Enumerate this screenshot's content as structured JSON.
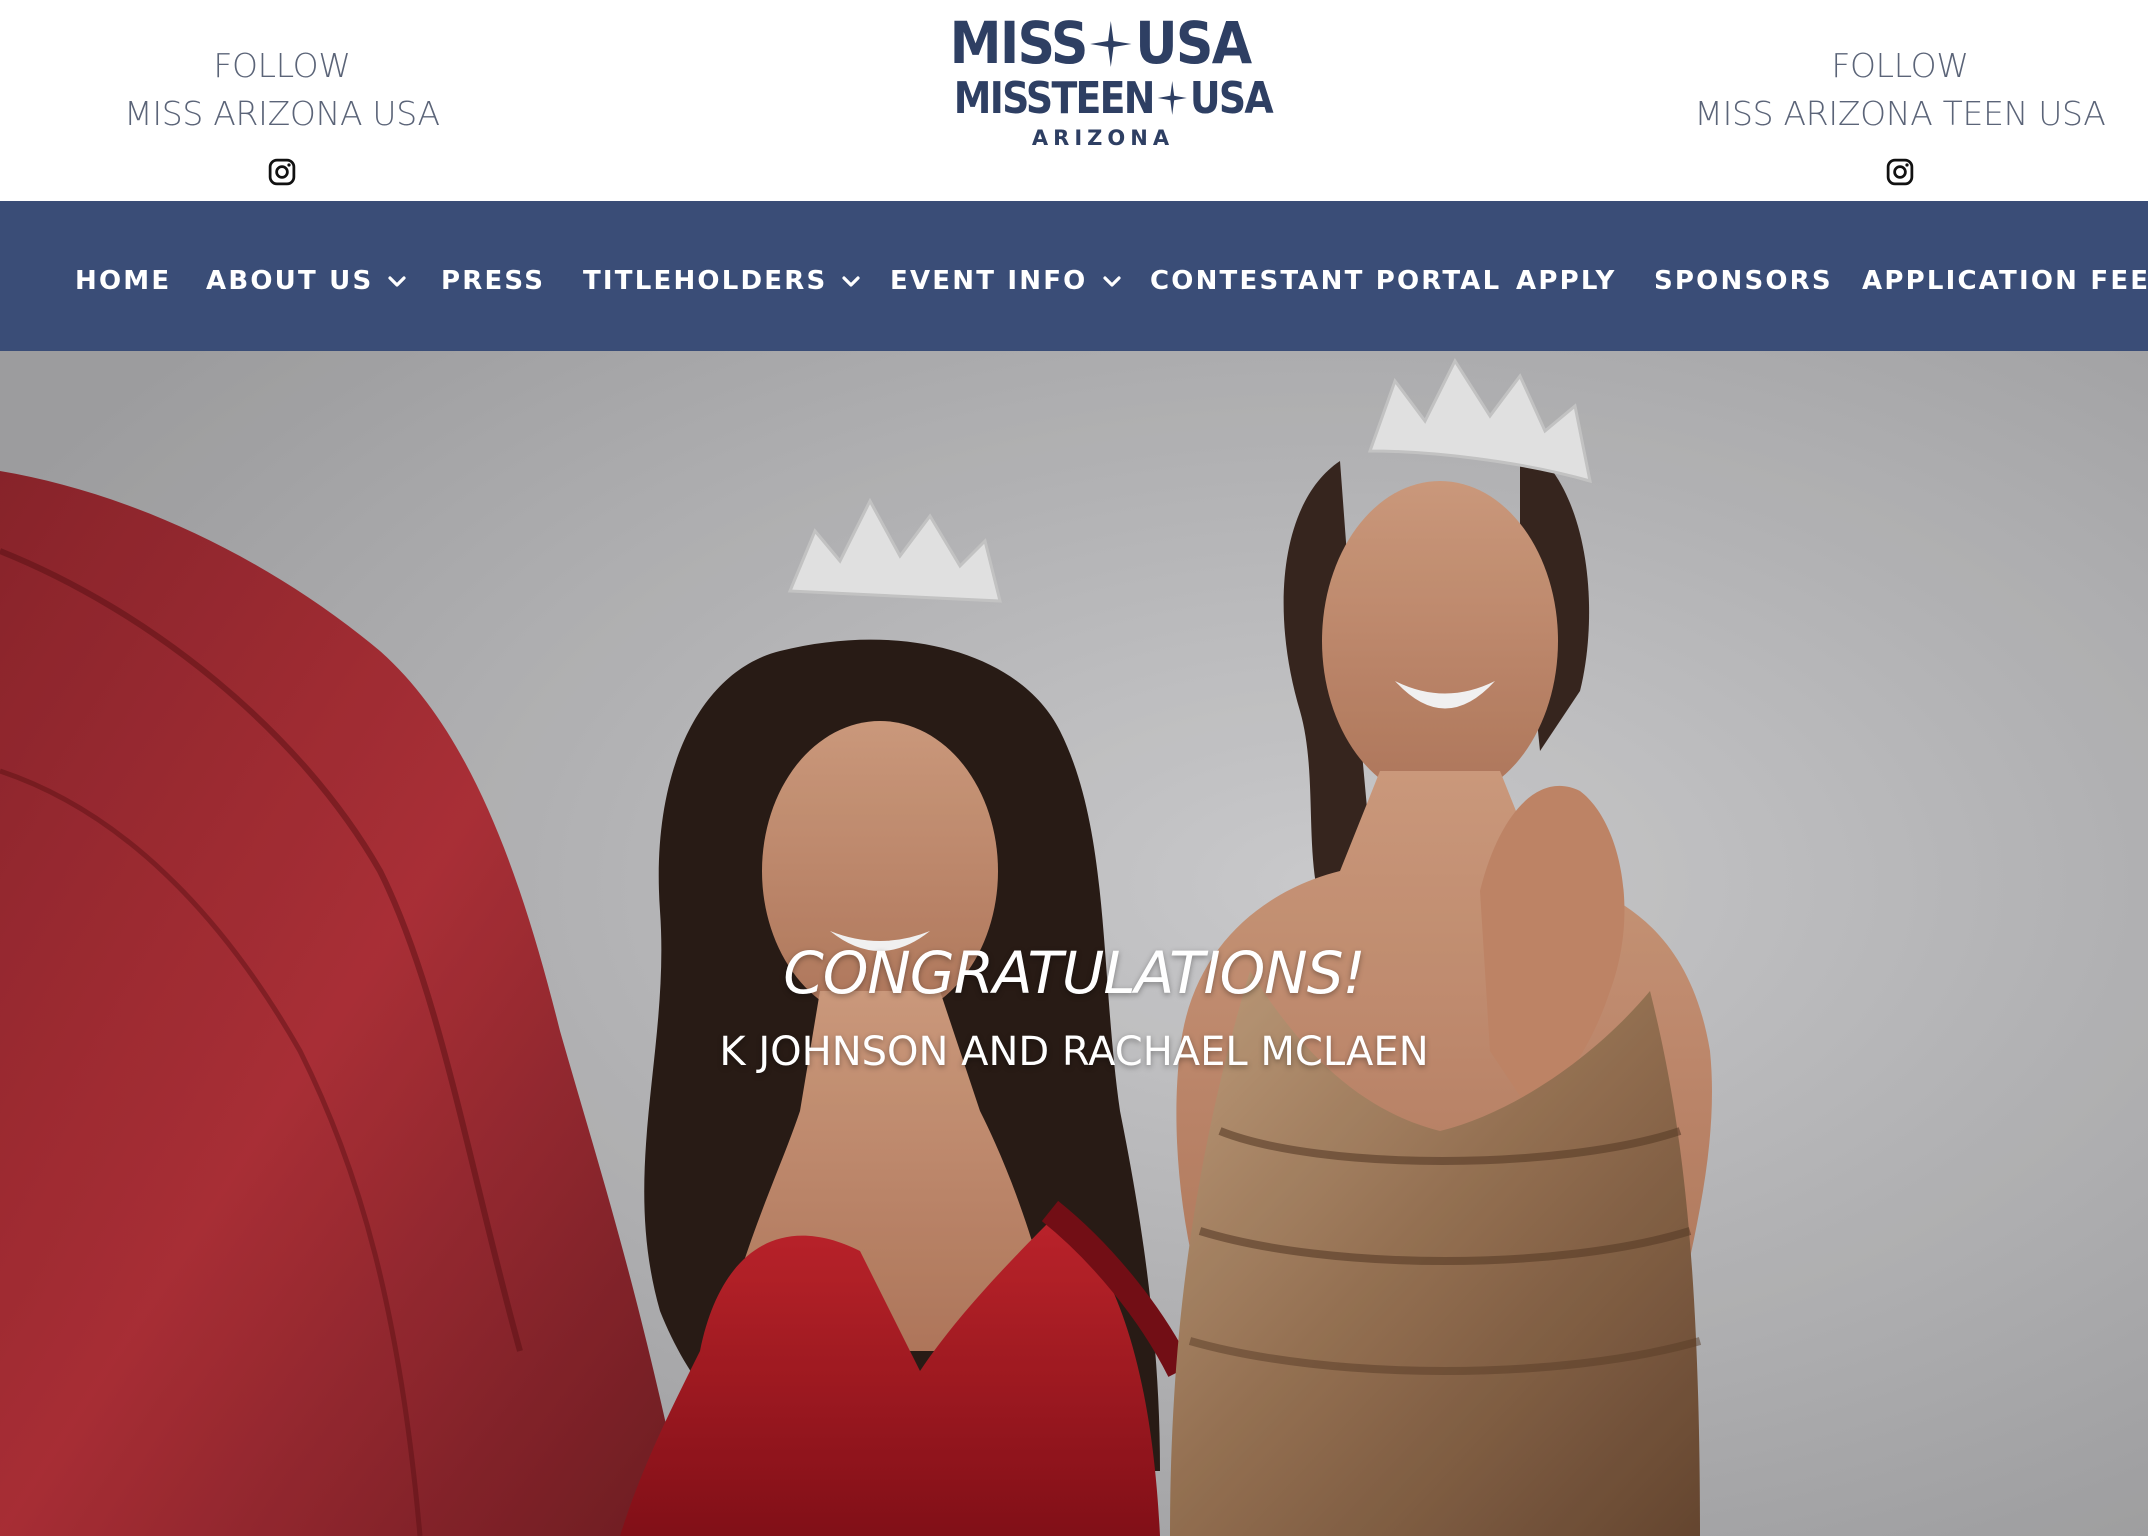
{
  "header": {
    "left_follow": {
      "line1": "FOLLOW",
      "line2": "MISS ARIZONA USA",
      "icon": "instagram-icon"
    },
    "right_follow": {
      "line1": "FOLLOW",
      "line2": "MISS ARIZONA TEEN USA",
      "icon": "instagram-icon"
    },
    "logo": {
      "row1_left": "MISS",
      "row1_right": "USA",
      "row2_left": "MISSTEEN",
      "row2_right": "USA",
      "row3": "ARIZONA",
      "color": "#2e3f63"
    }
  },
  "nav": {
    "background": "#3a4d77",
    "items": [
      {
        "label": "HOME",
        "has_dropdown": false
      },
      {
        "label": "ABOUT US",
        "has_dropdown": true
      },
      {
        "label": "PRESS",
        "has_dropdown": false
      },
      {
        "label": "TITLEHOLDERS",
        "has_dropdown": true
      },
      {
        "label": "EVENT INFO",
        "has_dropdown": true
      },
      {
        "label": "CONTESTANT PORTAL",
        "has_dropdown": false
      },
      {
        "label": "APPLY",
        "has_dropdown": false
      },
      {
        "label": "SPONSORS",
        "has_dropdown": false
      },
      {
        "label": "APPLICATION FEE",
        "has_dropdown": false
      }
    ]
  },
  "hero": {
    "title": "CONGRATULATIONS!",
    "subtitle": "K JOHNSON AND RACHAEL MCLAEN",
    "image": "two titleholders wearing crowns, one in a red gown and one in a gold gown"
  }
}
